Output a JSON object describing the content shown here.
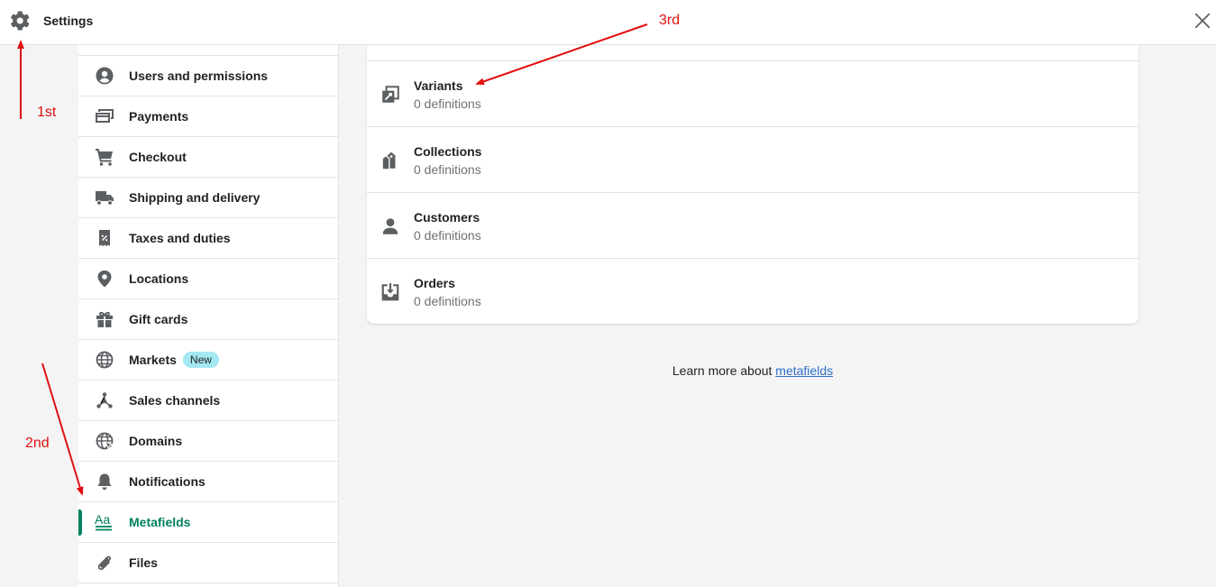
{
  "header": {
    "title": "Settings",
    "settings_icon": "gear-icon",
    "close_icon": "close-icon"
  },
  "sidebar": {
    "items": [
      {
        "label": "Users and permissions",
        "icon": "user-circle-icon"
      },
      {
        "label": "Payments",
        "icon": "payments-icon"
      },
      {
        "label": "Checkout",
        "icon": "cart-icon"
      },
      {
        "label": "Shipping and delivery",
        "icon": "truck-icon"
      },
      {
        "label": "Taxes and duties",
        "icon": "tax-receipt-icon"
      },
      {
        "label": "Locations",
        "icon": "location-pin-icon"
      },
      {
        "label": "Gift cards",
        "icon": "gift-icon"
      },
      {
        "label": "Markets",
        "icon": "globe-icon",
        "badge": "New"
      },
      {
        "label": "Sales channels",
        "icon": "channels-icon"
      },
      {
        "label": "Domains",
        "icon": "domain-globe-icon"
      },
      {
        "label": "Notifications",
        "icon": "bell-icon"
      },
      {
        "label": "Metafields",
        "icon": "metafields-icon",
        "active": true
      },
      {
        "label": "Files",
        "icon": "paperclip-icon"
      }
    ]
  },
  "metafields": {
    "rows": [
      {
        "name": "Variants",
        "sub": "0 definitions",
        "icon": "variants-icon"
      },
      {
        "name": "Collections",
        "sub": "0 definitions",
        "icon": "collections-icon"
      },
      {
        "name": "Customers",
        "sub": "0 definitions",
        "icon": "customer-icon"
      },
      {
        "name": "Orders",
        "sub": "0 definitions",
        "icon": "orders-icon"
      }
    ]
  },
  "learn_more": {
    "prefix": "Learn more about ",
    "link": "metafields"
  },
  "annotations": {
    "first": "1st",
    "second": "2nd",
    "third": "3rd"
  },
  "colors": {
    "accent": "#008060",
    "annotation": "#e01010",
    "link": "#2c6ecb",
    "badge": "#a4e8f2"
  }
}
